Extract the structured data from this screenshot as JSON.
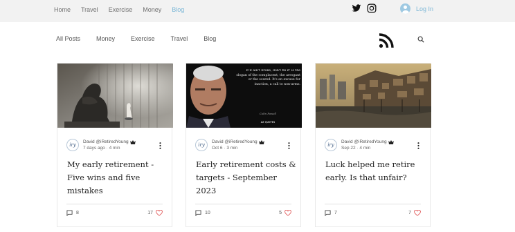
{
  "topnav": {
    "items": [
      "Home",
      "Travel",
      "Exercise",
      "Money",
      "Blog"
    ],
    "active": "Blog"
  },
  "social": {
    "icons": [
      "twitter-icon",
      "instagram-icon"
    ]
  },
  "login": {
    "label": "Log In"
  },
  "categories": [
    "All Posts",
    "Money",
    "Exercise",
    "Travel",
    "Blog"
  ],
  "colors": {
    "accent": "#7ab6d6",
    "heart": "#e05a5a",
    "topbar_bg": "#f2f2f2"
  },
  "image_quote": {
    "text": "If it ain't broke, don't fix it' is the slogan of the complacent, the arrogant or the scared. It's an excuse for inaction, a call to non-arms.",
    "signature": "Colin Powell",
    "brand": "AZ QUOTES"
  },
  "posts": [
    {
      "author": "David @iRetiredYoung",
      "date": "7 days ago",
      "read_time": "4 min",
      "title": "My early retirement - Five wins and five mistakes",
      "comments": "8",
      "likes": "17"
    },
    {
      "author": "David @iRetiredYoung",
      "date": "Oct 6",
      "read_time": "3 min",
      "title": "Early retirement costs & targets - September 2023",
      "comments": "10",
      "likes": "5"
    },
    {
      "author": "David @iRetiredYoung",
      "date": "Sep 22",
      "read_time": "4 min",
      "title": "Luck helped me retire early. Is that unfair?",
      "comments": "7",
      "likes": "7"
    }
  ]
}
